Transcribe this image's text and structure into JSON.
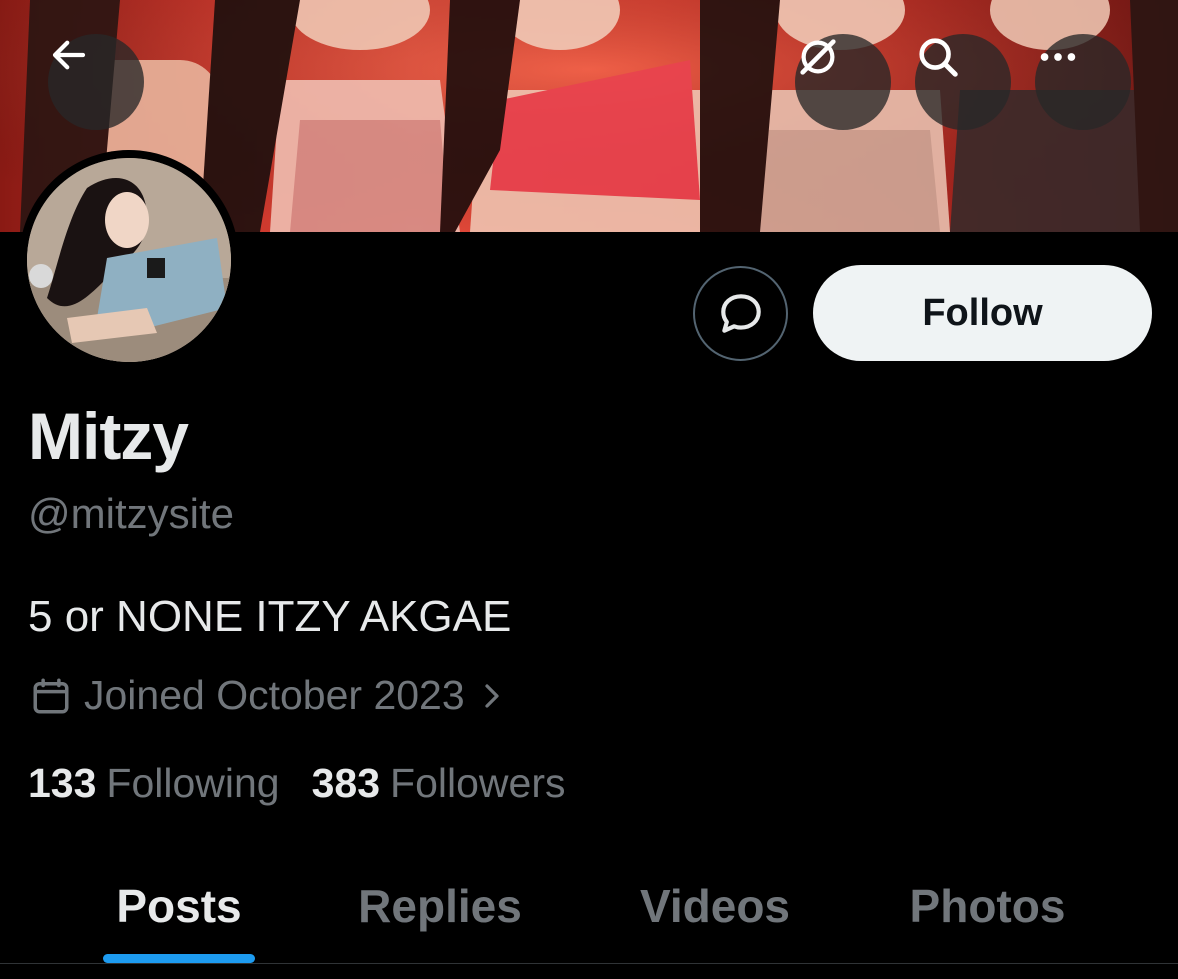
{
  "header": {
    "back_icon": "arrow-left-icon",
    "grok_icon": "grok-slash-icon",
    "search_icon": "search-icon",
    "more_icon": "more-horizontal-icon"
  },
  "profile": {
    "name": "Mitzy",
    "handle": "@mitzysite",
    "bio": "5 or NONE ITZY AKGAE",
    "joined": "Joined October 2023",
    "following_count": "133",
    "following_label": "Following",
    "followers_count": "383",
    "followers_label": "Followers"
  },
  "actions": {
    "message_icon": "message-bubble-icon",
    "follow_label": "Follow"
  },
  "tabs": [
    {
      "label": "Posts",
      "active": true
    },
    {
      "label": "Replies",
      "active": false
    },
    {
      "label": "Videos",
      "active": false
    },
    {
      "label": "Photos",
      "active": false
    }
  ],
  "colors": {
    "background": "#000000",
    "primary_text": "#e7e9ea",
    "secondary_text": "#71767b",
    "accent": "#1d9bf0",
    "follow_button_bg": "#eff3f4"
  }
}
